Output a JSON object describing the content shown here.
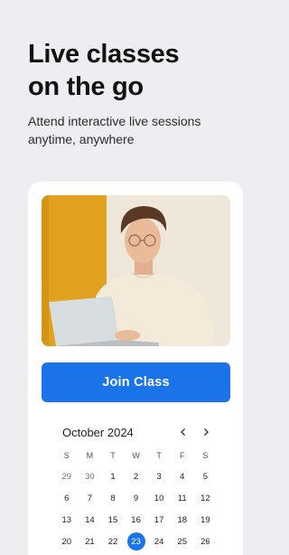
{
  "hero": {
    "title_line1": "Live classes",
    "title_line2": "on the go",
    "subtitle_line1": "Attend interactive live sessions",
    "subtitle_line2": "anytime, anywhere"
  },
  "card": {
    "photo_alt": "Student using a laptop",
    "join_button": "Join Class"
  },
  "calendar": {
    "month_label": "October 2024",
    "prev_icon": "chevron-left-icon",
    "next_icon": "chevron-right-icon",
    "weekdays": [
      "S",
      "M",
      "T",
      "W",
      "T",
      "F",
      "S"
    ],
    "weeks": [
      [
        "29",
        "30",
        "1",
        "2",
        "3",
        "4",
        "5"
      ],
      [
        "6",
        "7",
        "8",
        "9",
        "10",
        "11",
        "12"
      ],
      [
        "13",
        "14",
        "15",
        "16",
        "17",
        "18",
        "19"
      ],
      [
        "20",
        "21",
        "22",
        "23",
        "24",
        "25",
        "26"
      ]
    ],
    "muted_days": [
      "29",
      "30"
    ],
    "selected_day": "23"
  },
  "colors": {
    "accent": "#1a73e8",
    "background": "#eceef1",
    "card": "#ffffff"
  }
}
